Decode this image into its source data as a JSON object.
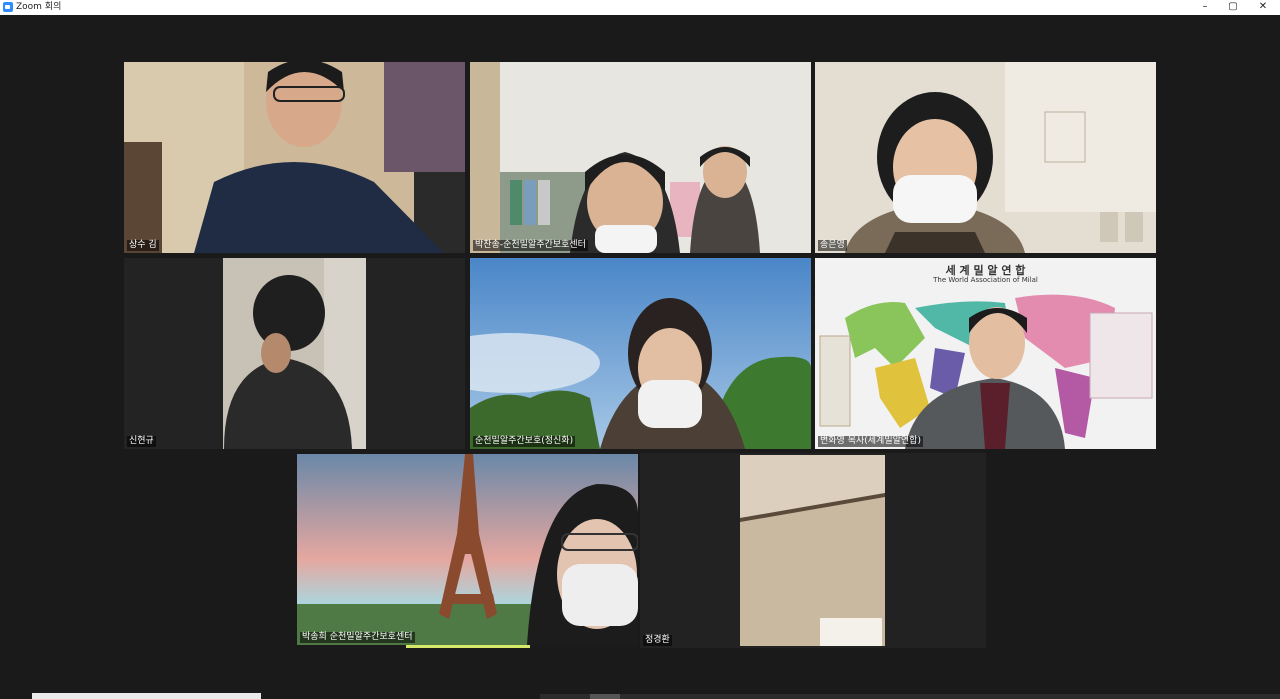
{
  "window": {
    "title": "Zoom 회의",
    "controls": [
      "–",
      "▢",
      "✕"
    ]
  },
  "participants": [
    {
      "name": "상수 김"
    },
    {
      "name": "박찬송-순천밀알주간보호센터"
    },
    {
      "name": "송은영"
    },
    {
      "name": "신현규"
    },
    {
      "name": "순천밀알주간보호(정신화)"
    },
    {
      "name": "변화영 목사(세계밀알연합)"
    },
    {
      "name": "박송희 순천밀알주간보호센터"
    },
    {
      "name": "정경환"
    }
  ],
  "slide": {
    "title": "세 계 밀 알 연 합",
    "subtitle": "The World Association of Milal"
  },
  "colors": {
    "active_speaker": "#d5e86a",
    "background": "#1a1a1a"
  },
  "icons": {
    "app": "zoom-camera-icon"
  }
}
